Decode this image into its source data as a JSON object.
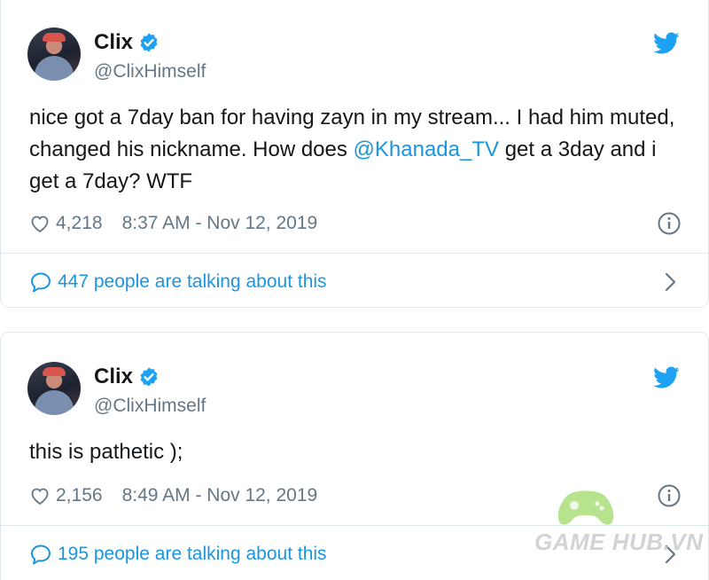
{
  "tweets": [
    {
      "display_name": "Clix",
      "handle": "@ClixHimself",
      "text_before": "nice got a 7day ban for having zayn in my stream... I had him muted, changed his nickname. How does ",
      "mention": "@Khanada_TV",
      "text_after": " get a 3day and i get a 7day? WTF",
      "likes": "4,218",
      "timestamp": "8:37 AM - Nov 12, 2019",
      "talking": "447 people are talking about this"
    },
    {
      "display_name": "Clix",
      "handle": "@ClixHimself",
      "text_before": "this is pathetic );",
      "mention": "",
      "text_after": "",
      "likes": "2,156",
      "timestamp": "8:49 AM - Nov 12, 2019",
      "talking": "195 people are talking about this"
    }
  ],
  "watermark": {
    "text": "GAME HUB.VN"
  },
  "colors": {
    "link": "#1b95e0",
    "muted": "#657786",
    "text": "#14171a",
    "border": "#e1e8ed"
  },
  "icons": [
    "verified-badge-icon",
    "twitter-bird-icon",
    "heart-icon",
    "info-icon",
    "speech-bubble-icon",
    "chevron-right-icon"
  ]
}
